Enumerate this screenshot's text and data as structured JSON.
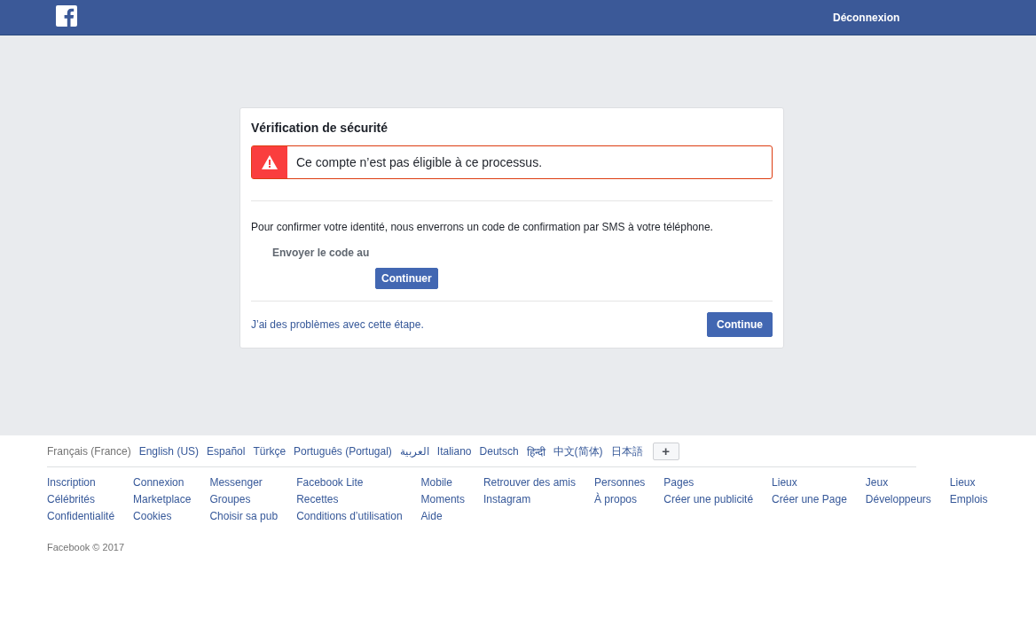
{
  "header": {
    "logout": "Déconnexion"
  },
  "card": {
    "title": "Vérification de sécurité",
    "error": "Ce compte n’est pas éligible à ce processus.",
    "description": "Pour confirmer votre identité, nous enverrons un code de confirmation par SMS à votre téléphone.",
    "send_label": "Envoyer le code au",
    "inner_button": "Continuer",
    "help_link": "J’ai des problèmes avec cette étape.",
    "continue_button": "Continue"
  },
  "languages": [
    {
      "label": "Français (France)",
      "selected": true
    },
    {
      "label": "English (US)",
      "selected": false
    },
    {
      "label": "Español",
      "selected": false
    },
    {
      "label": "Türkçe",
      "selected": false
    },
    {
      "label": "Português (Portugal)",
      "selected": false
    },
    {
      "label": "العربية",
      "selected": false
    },
    {
      "label": "Italiano",
      "selected": false
    },
    {
      "label": "Deutsch",
      "selected": false
    },
    {
      "label": "हिन्दी",
      "selected": false
    },
    {
      "label": "中文(简体)",
      "selected": false
    },
    {
      "label": "日本語",
      "selected": false
    }
  ],
  "more_languages": "+",
  "footer_links": [
    [
      "Inscription",
      "Célébrités",
      "Confidentialité"
    ],
    [
      "Connexion",
      "Marketplace",
      "Cookies"
    ],
    [
      "Messenger",
      "Groupes",
      "Choisir sa pub"
    ],
    [
      "Facebook Lite",
      "Recettes",
      "Conditions d’utilisation"
    ],
    [
      "Mobile",
      "Moments",
      "Aide"
    ],
    [
      "Retrouver des amis",
      "Instagram"
    ],
    [
      "Personnes",
      "À propos"
    ],
    [
      "Pages",
      "Créer une publicité"
    ],
    [
      "Lieux",
      "Créer une Page"
    ],
    [
      "Jeux",
      "Développeurs"
    ],
    [
      "Lieux",
      "Emplois"
    ]
  ],
  "copyright": "Facebook © 2017"
}
